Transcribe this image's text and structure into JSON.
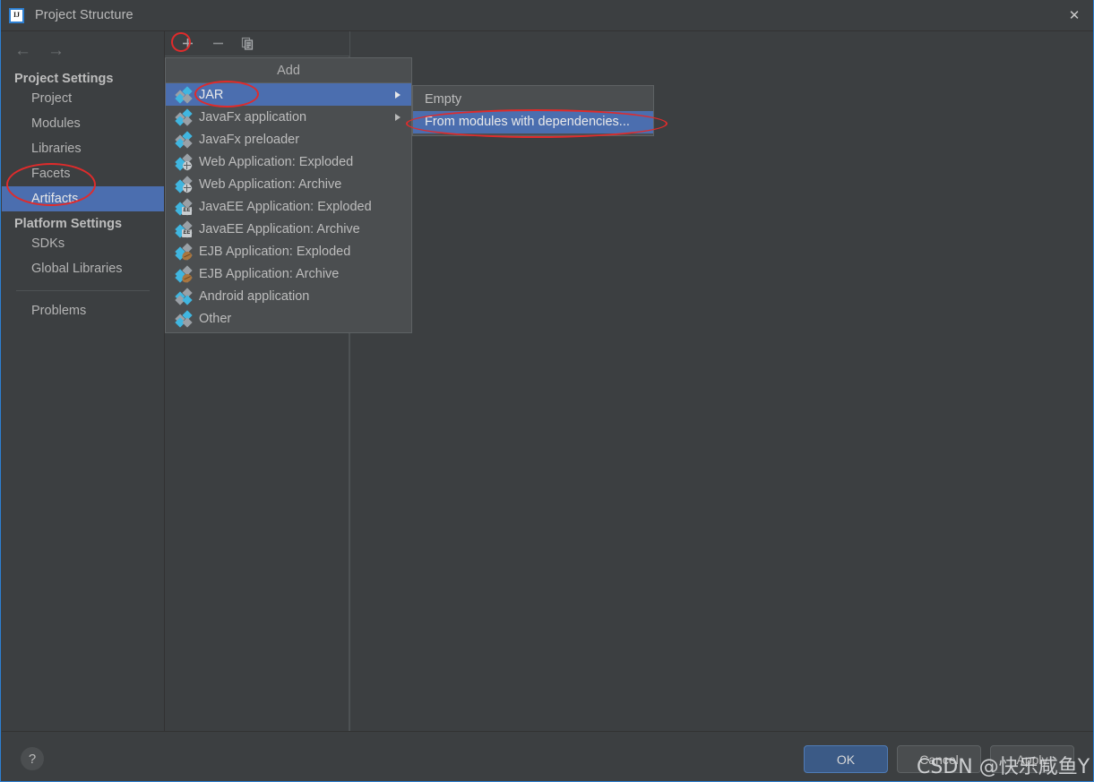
{
  "window": {
    "title": "Project Structure",
    "logo_text": "IJ",
    "close_icon": "close-icon"
  },
  "sidebar": {
    "nav_back": "←",
    "nav_forward": "→",
    "sections": [
      {
        "heading": "Project Settings",
        "items": [
          {
            "label": "Project",
            "selected": false
          },
          {
            "label": "Modules",
            "selected": false
          },
          {
            "label": "Libraries",
            "selected": false
          },
          {
            "label": "Facets",
            "selected": false
          },
          {
            "label": "Artifacts",
            "selected": true
          }
        ]
      },
      {
        "heading": "Platform Settings",
        "items": [
          {
            "label": "SDKs",
            "selected": false
          },
          {
            "label": "Global Libraries",
            "selected": false
          }
        ]
      }
    ],
    "footer_items": [
      {
        "label": "Problems",
        "selected": false
      }
    ]
  },
  "toolbar": {
    "add_icon": "plus-icon",
    "remove_icon": "minus-icon",
    "copy_icon": "copy-icon"
  },
  "menu": {
    "header": "Add",
    "items": [
      {
        "label": "JAR",
        "icon": "jar-icon",
        "selected": true,
        "submenu": true
      },
      {
        "label": "JavaFx application",
        "icon": "javafx-icon",
        "selected": false,
        "submenu": true
      },
      {
        "label": "JavaFx preloader",
        "icon": "javafx-icon",
        "selected": false,
        "submenu": false
      },
      {
        "label": "Web Application: Exploded",
        "icon": "web-icon",
        "selected": false,
        "submenu": false
      },
      {
        "label": "Web Application: Archive",
        "icon": "web-icon",
        "selected": false,
        "submenu": false
      },
      {
        "label": "JavaEE Application: Exploded",
        "icon": "javaee-icon",
        "selected": false,
        "submenu": false
      },
      {
        "label": "JavaEE Application: Archive",
        "icon": "javaee-icon",
        "selected": false,
        "submenu": false
      },
      {
        "label": "EJB Application: Exploded",
        "icon": "ejb-icon",
        "selected": false,
        "submenu": false
      },
      {
        "label": "EJB Application: Archive",
        "icon": "ejb-icon",
        "selected": false,
        "submenu": false
      },
      {
        "label": "Android application",
        "icon": "android-icon",
        "selected": false,
        "submenu": false
      },
      {
        "label": "Other",
        "icon": "other-icon",
        "selected": false,
        "submenu": false
      }
    ]
  },
  "submenu": {
    "items": [
      {
        "label": "Empty",
        "selected": false
      },
      {
        "label": "From modules with dependencies...",
        "selected": true
      }
    ]
  },
  "bottom": {
    "help_label": "?",
    "ok_label": "OK",
    "cancel_label": "Cancel",
    "apply_label": "Apply"
  },
  "watermark": {
    "text": "CSDN @快乐咸鱼Y"
  },
  "colors": {
    "background": "#3c3f41",
    "selection_blue": "#4b6eaf",
    "accent_blue": "#2d7fd1",
    "annotation_red": "#e02b2b",
    "icon_blue": "#40b6e0",
    "ok_button": "#3b5a86"
  }
}
